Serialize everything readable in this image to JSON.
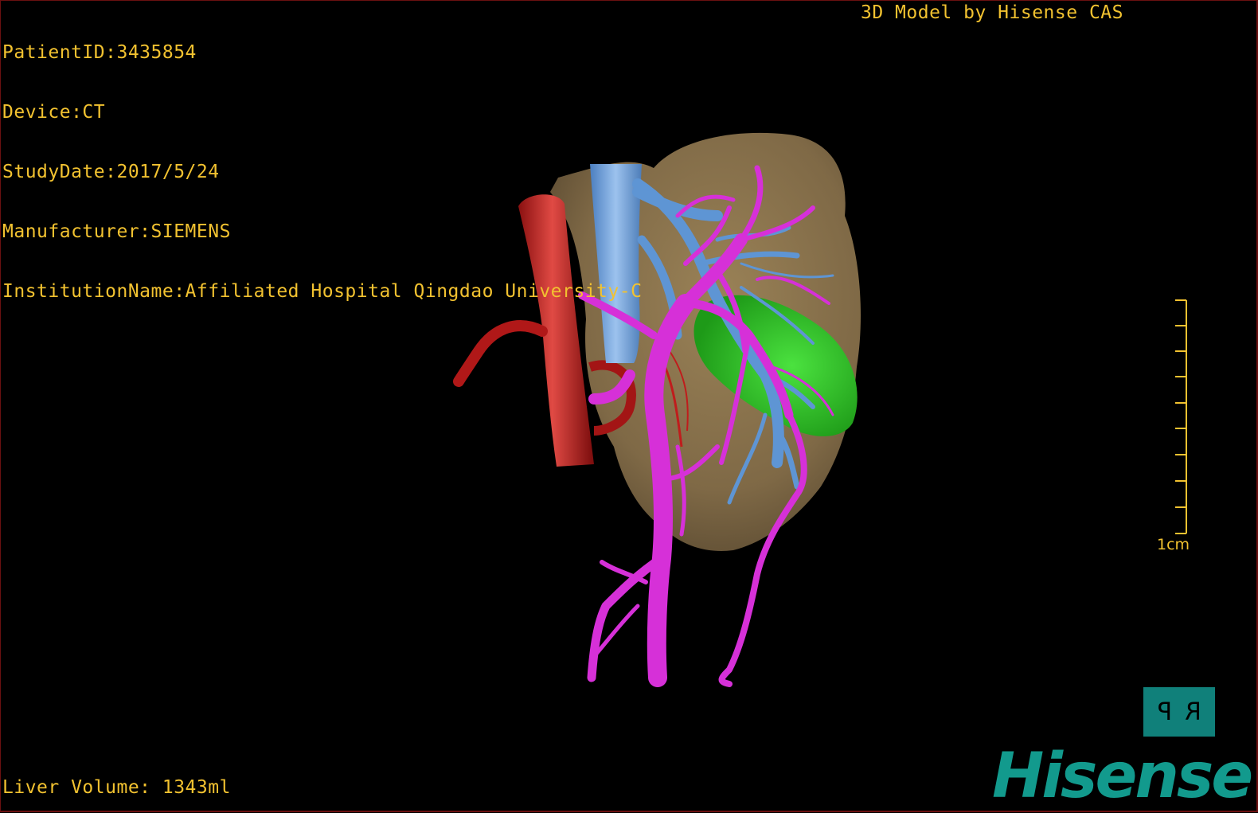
{
  "header": {
    "patient_id": "PatientID:3435854",
    "device": "Device:CT",
    "study_date": "StudyDate:2017/5/24",
    "manufacturer": "Manufacturer:SIEMENS",
    "institution": "InstitutionName:Affiliated Hospital Qingdao University-C",
    "credit": "3D Model by Hisense CAS"
  },
  "footer": {
    "liver_volume": "Liver Volume: 1343ml"
  },
  "scale": {
    "label": "1cm"
  },
  "orientation": {
    "left_label": "P",
    "right_label": "R"
  },
  "brand": {
    "name": "Hisense"
  },
  "colors": {
    "overlay_text": "#f2c230",
    "liver": "#86704a",
    "inferior_vena_cava": "#6e9fd6",
    "aorta": "#c8201e",
    "portal_vein": "#d630d8",
    "tumor": "#2fc627",
    "brand": "#129a8d",
    "orientation_cube": "#10807a"
  }
}
